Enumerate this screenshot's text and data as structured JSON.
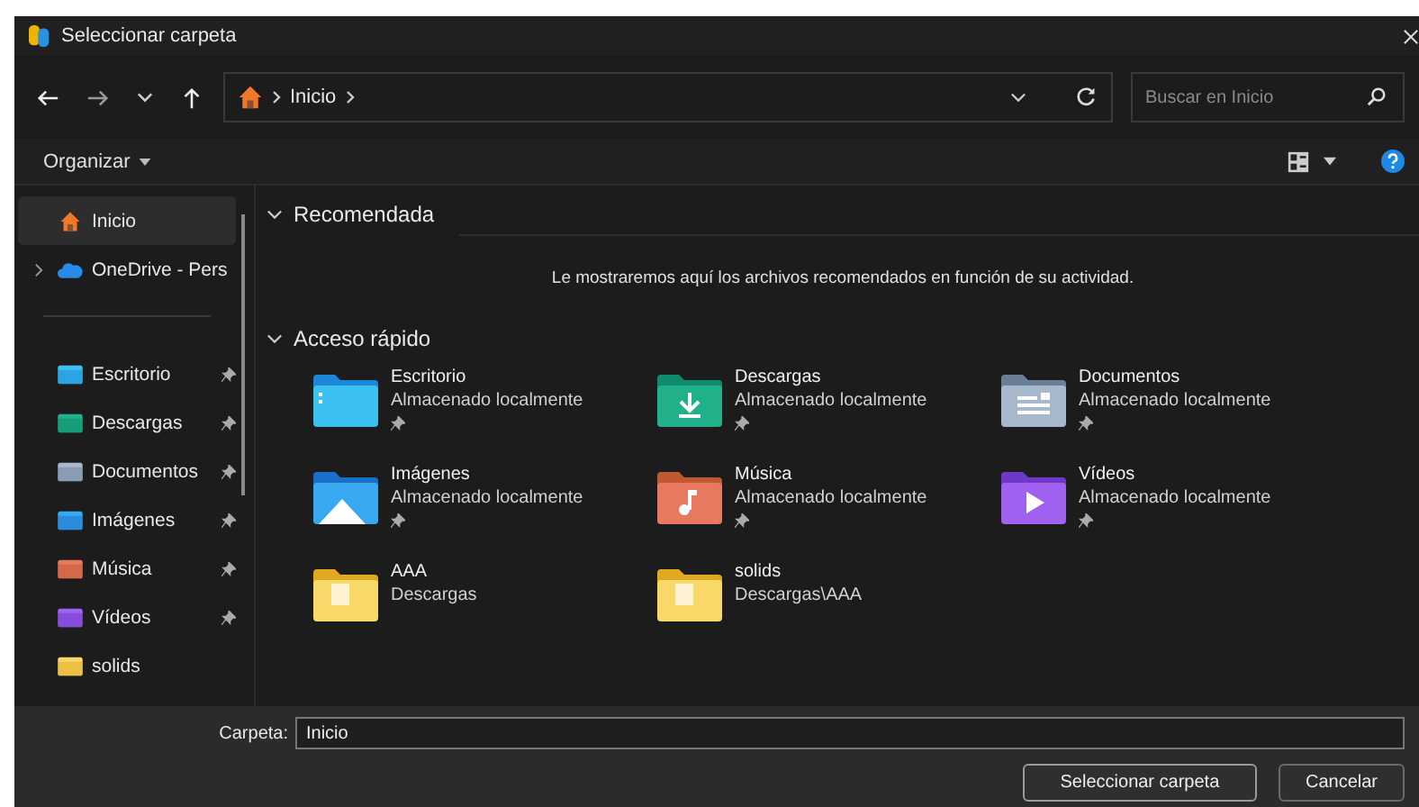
{
  "window": {
    "title": "Seleccionar carpeta"
  },
  "address_bar": {
    "crumbs": [
      "Inicio"
    ]
  },
  "search": {
    "placeholder": "Buscar en Inicio"
  },
  "command_bar": {
    "organize": "Organizar"
  },
  "sidebar": {
    "items": [
      {
        "label": "Inicio",
        "kind": "home",
        "selected": true,
        "pinned": false,
        "expandable": false
      },
      {
        "label": "OneDrive - Pers",
        "kind": "cloud",
        "selected": false,
        "pinned": false,
        "expandable": true
      },
      {
        "label": "Escritorio",
        "kind": "desktop",
        "selected": false,
        "pinned": true,
        "expandable": false
      },
      {
        "label": "Descargas",
        "kind": "downloads",
        "selected": false,
        "pinned": true,
        "expandable": false
      },
      {
        "label": "Documentos",
        "kind": "documents",
        "selected": false,
        "pinned": true,
        "expandable": false
      },
      {
        "label": "Imágenes",
        "kind": "pictures",
        "selected": false,
        "pinned": true,
        "expandable": false
      },
      {
        "label": "Música",
        "kind": "music",
        "selected": false,
        "pinned": true,
        "expandable": false
      },
      {
        "label": "Vídeos",
        "kind": "videos",
        "selected": false,
        "pinned": true,
        "expandable": false
      },
      {
        "label": "solids",
        "kind": "folder",
        "selected": false,
        "pinned": false,
        "expandable": false
      }
    ]
  },
  "sections": [
    {
      "title": "Recomendada",
      "expanded": true,
      "message": "Le mostraremos aquí los archivos recomendados en función de su actividad."
    },
    {
      "title": "Acceso rápido",
      "expanded": true,
      "items": [
        {
          "name": "Escritorio",
          "location": "Almacenado localmente",
          "kind": "desktop",
          "pinned": true
        },
        {
          "name": "Descargas",
          "location": "Almacenado localmente",
          "kind": "downloads",
          "pinned": true
        },
        {
          "name": "Documentos",
          "location": "Almacenado localmente",
          "kind": "documents",
          "pinned": true
        },
        {
          "name": "Imágenes",
          "location": "Almacenado localmente",
          "kind": "pictures",
          "pinned": true
        },
        {
          "name": "Música",
          "location": "Almacenado localmente",
          "kind": "music",
          "pinned": true
        },
        {
          "name": "Vídeos",
          "location": "Almacenado localmente",
          "kind": "videos",
          "pinned": true
        },
        {
          "name": "AAA",
          "location": "Descargas",
          "kind": "folder",
          "pinned": false
        },
        {
          "name": "solids",
          "location": "Descargas\\AAA",
          "kind": "folder",
          "pinned": false
        }
      ]
    }
  ],
  "footer": {
    "folder_label": "Carpeta:",
    "folder_value": "Inicio",
    "buttons": [
      "Seleccionar carpeta",
      "Cancelar"
    ]
  }
}
